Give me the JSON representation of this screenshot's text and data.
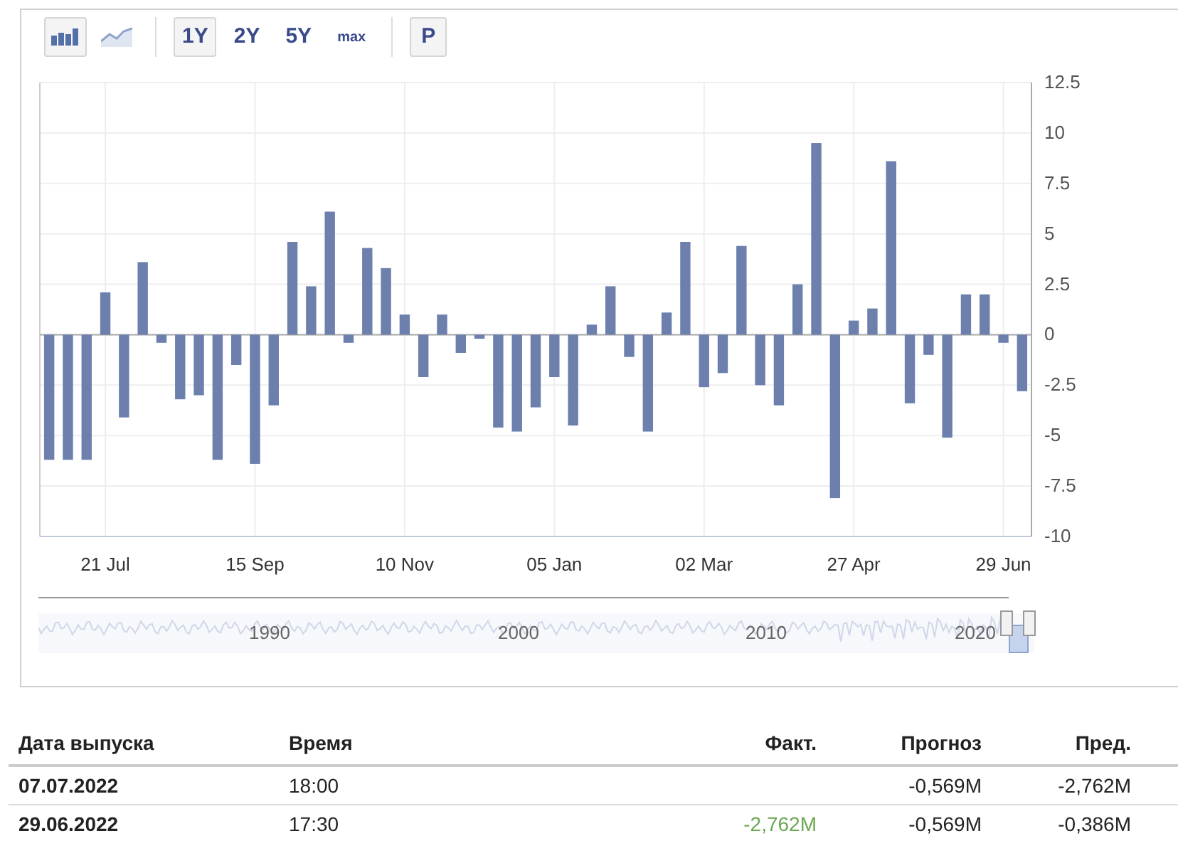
{
  "toolbar": {
    "chart_types": [
      {
        "kind": "bar",
        "selected": true
      },
      {
        "kind": "area",
        "selected": false
      }
    ],
    "ranges": [
      {
        "label": "1Y",
        "selected": true
      },
      {
        "label": "2Y",
        "selected": false
      },
      {
        "label": "5Y",
        "selected": false
      },
      {
        "label": "max",
        "selected": false
      }
    ],
    "extra": {
      "label": "P",
      "selected": true
    }
  },
  "chart": {
    "chart_data": {
      "type": "bar",
      "categories": [
        null,
        null,
        null,
        "21 Jul",
        null,
        null,
        null,
        null,
        null,
        null,
        null,
        "15 Sep",
        null,
        null,
        null,
        null,
        null,
        null,
        null,
        "10 Nov",
        null,
        null,
        null,
        null,
        null,
        null,
        null,
        "05 Jan",
        null,
        null,
        null,
        null,
        null,
        null,
        null,
        "02 Mar",
        null,
        null,
        null,
        null,
        null,
        null,
        null,
        "27 Apr",
        null,
        null,
        null,
        null,
        null,
        null,
        null,
        "29 Jun",
        null
      ],
      "series": [
        {
          "color": "#6c7fad",
          "values": [
            -6.2,
            -6.2,
            -6.2,
            2.1,
            -4.1,
            3.6,
            -0.4,
            -3.2,
            -3.0,
            -6.2,
            -1.5,
            -6.4,
            -3.5,
            4.6,
            2.4,
            6.1,
            -0.4,
            4.3,
            3.3,
            1.0,
            -2.1,
            1.0,
            -0.9,
            -0.2,
            -4.6,
            -4.8,
            -3.6,
            -2.1,
            -4.5,
            0.5,
            2.4,
            -1.1,
            -4.8,
            1.1,
            4.6,
            -2.6,
            -1.9,
            4.4,
            -2.5,
            -3.5,
            2.5,
            9.5,
            -8.1,
            0.7,
            1.3,
            8.6,
            -3.4,
            -1.0,
            -5.1,
            2.0,
            2.0,
            -0.4,
            -2.8
          ]
        }
      ],
      "grid": true,
      "ylim": [
        -10,
        12.5
      ],
      "yticks": [
        -10,
        -7.5,
        -5,
        -2.5,
        0,
        2.5,
        5,
        7.5,
        10,
        12.5
      ]
    }
  },
  "navigator": {
    "labels": [
      "1990",
      "2000",
      "2010",
      "2020"
    ]
  },
  "table": {
    "columns": [
      "Дата выпуска",
      "Время",
      "Факт.",
      "Прогноз",
      "Пред."
    ],
    "rows": [
      {
        "date": "07.07.2022",
        "time": "18:00",
        "forecast": "-0,569M",
        "previous": "-2,762M"
      },
      {
        "date": "29.06.2022",
        "time": "17:30",
        "actual": "-2,762M",
        "color": "#6aa84f",
        "forecast": "-0,569M",
        "previous": "-0,386M"
      }
    ]
  }
}
